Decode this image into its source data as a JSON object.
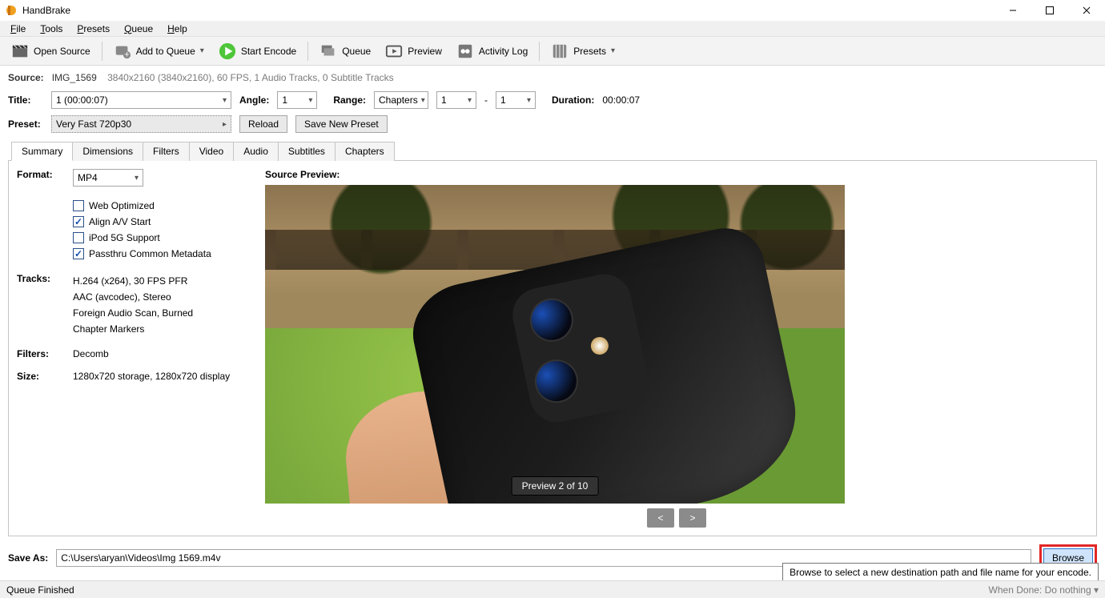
{
  "window": {
    "title": "HandBrake"
  },
  "menubar": [
    "File",
    "Tools",
    "Presets",
    "Queue",
    "Help"
  ],
  "toolbar": {
    "open_source": "Open Source",
    "add_queue": "Add to Queue",
    "start_encode": "Start Encode",
    "queue": "Queue",
    "preview": "Preview",
    "activity": "Activity Log",
    "presets": "Presets"
  },
  "source": {
    "label": "Source:",
    "name": "IMG_1569",
    "details": "3840x2160 (3840x2160), 60 FPS, 1 Audio Tracks, 0 Subtitle Tracks"
  },
  "title_row": {
    "title_label": "Title:",
    "title_value": "1  (00:00:07)",
    "angle_label": "Angle:",
    "angle_value": "1",
    "range_label": "Range:",
    "range_type": "Chapters",
    "range_from": "1",
    "range_sep": "-",
    "range_to": "1",
    "duration_label": "Duration:",
    "duration_value": "00:00:07"
  },
  "preset_row": {
    "label": "Preset:",
    "value": "Very Fast 720p30",
    "reload": "Reload",
    "save_new": "Save New Preset"
  },
  "tabs": [
    "Summary",
    "Dimensions",
    "Filters",
    "Video",
    "Audio",
    "Subtitles",
    "Chapters"
  ],
  "summary": {
    "format_label": "Format:",
    "format_value": "MP4",
    "chk_web": "Web Optimized",
    "chk_align": "Align A/V Start",
    "chk_ipod": "iPod 5G Support",
    "chk_meta": "Passthru Common Metadata",
    "tracks_label": "Tracks:",
    "tracks": [
      "H.264 (x264), 30 FPS PFR",
      "AAC (avcodec), Stereo",
      "Foreign Audio Scan, Burned",
      "Chapter Markers"
    ],
    "filters_label": "Filters:",
    "filters_value": "Decomb",
    "size_label": "Size:",
    "size_value": "1280x720 storage, 1280x720 display",
    "preview_label": "Source Preview:",
    "preview_badge": "Preview 2 of 10",
    "prev": "<",
    "next": ">"
  },
  "saveas": {
    "label": "Save As:",
    "path": "C:\\Users\\aryan\\Videos\\Img 1569.m4v",
    "browse": "Browse",
    "tooltip": "Browse to select a new destination path and file name for your encode."
  },
  "status": {
    "left": "Queue Finished",
    "right_label": "When Done:",
    "right_value": "Do nothing"
  }
}
